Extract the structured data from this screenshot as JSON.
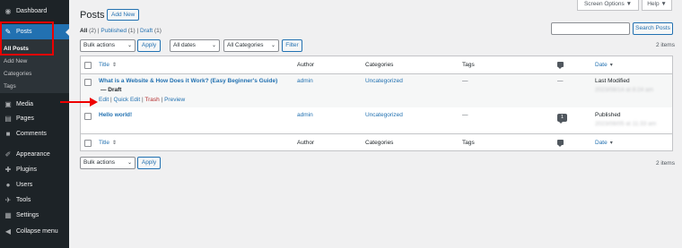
{
  "sidebar": {
    "items": [
      {
        "label": "Dashboard",
        "icon": "dashboard-icon"
      },
      {
        "label": "Posts",
        "icon": "pin-icon"
      },
      {
        "label": "Media",
        "icon": "media-icon"
      },
      {
        "label": "Pages",
        "icon": "pages-icon"
      },
      {
        "label": "Comments",
        "icon": "comments-icon"
      },
      {
        "label": "Appearance",
        "icon": "appearance-icon"
      },
      {
        "label": "Plugins",
        "icon": "plugins-icon"
      },
      {
        "label": "Users",
        "icon": "users-icon"
      },
      {
        "label": "Tools",
        "icon": "tools-icon"
      },
      {
        "label": "Settings",
        "icon": "settings-icon"
      },
      {
        "label": "Collapse menu",
        "icon": "collapse-icon"
      }
    ],
    "posts_submenu": [
      "All Posts",
      "Add New",
      "Categories",
      "Tags"
    ]
  },
  "header": {
    "title": "Posts",
    "add_new": "Add New",
    "screen_options": "Screen Options ▼",
    "help": "Help ▼"
  },
  "views": {
    "all": "All",
    "all_count": "(2)",
    "published": "Published",
    "published_count": "(1)",
    "draft": "Draft",
    "draft_count": "(1)"
  },
  "search": {
    "button": "Search Posts",
    "value": ""
  },
  "filters": {
    "bulk_actions": "Bulk actions",
    "apply": "Apply",
    "dates": "All dates",
    "categories": "All Categories",
    "filter": "Filter",
    "items_count": "2 items"
  },
  "table": {
    "columns": [
      "Title",
      "Author",
      "Categories",
      "Tags",
      "Date"
    ],
    "rows": [
      {
        "title": "What is a Website & How Does it Work? (Easy Beginner's Guide)",
        "state": "— Draft",
        "actions": {
          "edit": "Edit",
          "quick_edit": "Quick Edit",
          "trash": "Trash",
          "preview": "Preview"
        },
        "author": "admin",
        "categories": "Uncategorized",
        "tags": "—",
        "comments": "—",
        "date_status": "Last Modified",
        "date_value": "2023/08/14 at 8:24 am"
      },
      {
        "title": "Hello world!",
        "author": "admin",
        "categories": "Uncategorized",
        "tags": "—",
        "comments": "1",
        "date_status": "Published",
        "date_value": "2023/08/05 at 11:33 am"
      }
    ]
  },
  "colors": {
    "accent": "#2271b1",
    "sidebar": "#1d2327",
    "highlight": "#e00000"
  }
}
